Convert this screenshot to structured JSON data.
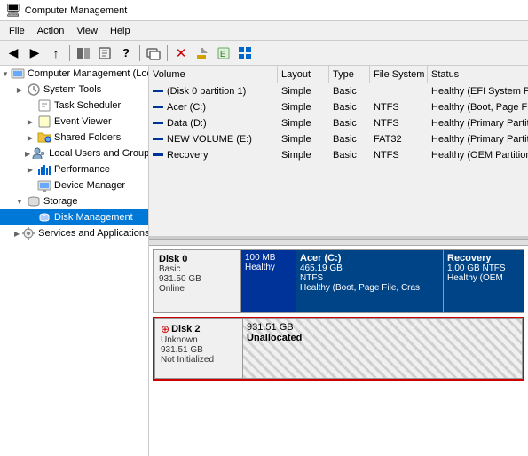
{
  "titleBar": {
    "title": "Computer Management",
    "icon": "💻"
  },
  "menuBar": {
    "items": [
      "File",
      "Action",
      "View",
      "Help"
    ]
  },
  "toolbar": {
    "buttons": [
      "←",
      "→",
      "↑",
      "⬛",
      "⬛",
      "?",
      "⬛",
      "⬛",
      "❌",
      "⬛",
      "⬛",
      "⬛",
      "⬛"
    ]
  },
  "leftPanel": {
    "root": "Computer Management (Local",
    "items": [
      {
        "label": "System Tools",
        "level": 1,
        "expand": "▶",
        "icon": "🔧"
      },
      {
        "label": "Task Scheduler",
        "level": 2,
        "expand": "",
        "icon": "📅"
      },
      {
        "label": "Event Viewer",
        "level": 2,
        "expand": "▶",
        "icon": "📋"
      },
      {
        "label": "Shared Folders",
        "level": 2,
        "expand": "▶",
        "icon": "📁"
      },
      {
        "label": "Local Users and Groups",
        "level": 2,
        "expand": "▶",
        "icon": "👤"
      },
      {
        "label": "Performance",
        "level": 2,
        "expand": "▶",
        "icon": "📊"
      },
      {
        "label": "Device Manager",
        "level": 2,
        "expand": "",
        "icon": "🖥"
      },
      {
        "label": "Storage",
        "level": 1,
        "expand": "▼",
        "icon": "💾"
      },
      {
        "label": "Disk Management",
        "level": 2,
        "expand": "",
        "icon": "💿",
        "selected": true
      },
      {
        "label": "Services and Applications",
        "level": 1,
        "expand": "▶",
        "icon": "⚙"
      }
    ]
  },
  "volumeTable": {
    "columns": [
      {
        "label": "Volume",
        "key": "volume"
      },
      {
        "label": "Layout",
        "key": "layout"
      },
      {
        "label": "Type",
        "key": "type"
      },
      {
        "label": "File System",
        "key": "fs"
      },
      {
        "label": "Status",
        "key": "status"
      }
    ],
    "rows": [
      {
        "volume": "(Disk 0 partition 1)",
        "layout": "Simple",
        "type": "Basic",
        "fs": "",
        "status": "Healthy (EFI System Partitio"
      },
      {
        "volume": "Acer (C:)",
        "layout": "Simple",
        "type": "Basic",
        "fs": "NTFS",
        "status": "Healthy (Boot, Page File, Cr"
      },
      {
        "volume": "Data (D:)",
        "layout": "Simple",
        "type": "Basic",
        "fs": "NTFS",
        "status": "Healthy (Primary Partition)"
      },
      {
        "volume": "NEW VOLUME (E:)",
        "layout": "Simple",
        "type": "Basic",
        "fs": "FAT32",
        "status": "Healthy (Primary Partition)"
      },
      {
        "volume": "Recovery",
        "layout": "Simple",
        "type": "Basic",
        "fs": "NTFS",
        "status": "Healthy (OEM Partition)"
      }
    ]
  },
  "diskView": {
    "disks": [
      {
        "id": "disk0",
        "name": "Disk 0",
        "type": "Basic",
        "size": "931.50 GB",
        "status": "Online",
        "highlighted": false,
        "partitions": [
          {
            "id": "p0-sys",
            "color": "system",
            "size": "100 MB",
            "name": "",
            "fstype": "",
            "status": "Healthy",
            "widthPct": 12
          },
          {
            "id": "p0-acer",
            "color": "primary",
            "size": "465.19 GB",
            "name": "Acer (C:)",
            "fstype": "NTFS",
            "status": "Healthy (Boot, Page File, Cras",
            "widthPct": 68
          },
          {
            "id": "p0-rec",
            "color": "primary",
            "size": "1.00 GB NTFS",
            "name": "Recovery",
            "fstype": "",
            "status": "Healthy (OEM",
            "widthPct": 20
          }
        ]
      },
      {
        "id": "disk2",
        "name": "Disk 2",
        "type": "Unknown",
        "size": "931.51 GB",
        "status": "Not Initialized",
        "highlighted": true,
        "icon": "❗",
        "partitions": [
          {
            "id": "p2-unalloc",
            "color": "unallocated",
            "size": "931.51 GB",
            "name": "Unallocated",
            "widthPct": 100
          }
        ]
      }
    ]
  },
  "icons": {
    "expand_closed": "▶",
    "expand_open": "▼",
    "dash": "—"
  }
}
